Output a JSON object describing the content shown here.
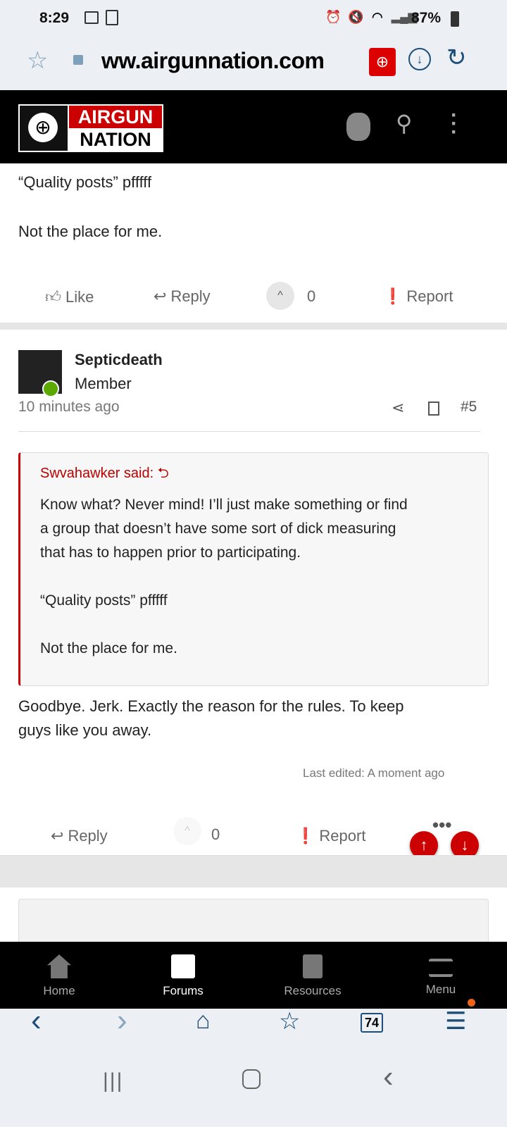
{
  "status": {
    "time": "8:29",
    "battery": "87%"
  },
  "browser": {
    "url": "ww.airgunnation.com",
    "tab_count": "74"
  },
  "logo": {
    "line1": "AIRGUN",
    "line2": "NATION"
  },
  "prev_post": {
    "line1": "“Quality posts” pfffff",
    "line2": "Not the place for me.",
    "like": "Like",
    "reply": "Reply",
    "votes": "0",
    "report": "Report"
  },
  "post": {
    "author": "Septicdeath",
    "role": "Member",
    "time": "10 minutes ago",
    "number": "#5",
    "quote_author": "Swvahawker said:",
    "quote_lines": [
      "Know what? Never mind! I’ll just make something or find",
      "a group that doesn’t have some sort of dick measuring",
      "that has to happen prior to participating.",
      "“Quality posts” pfffff",
      "Not the place for me."
    ],
    "body_lines": [
      "Goodbye. Jerk. Exactly the reason for the rules. To keep",
      "guys like you away."
    ],
    "edited": "Last edited: A moment ago",
    "reply": "Reply",
    "votes": "0",
    "report": "Report"
  },
  "nav": {
    "items": [
      {
        "label": "Home"
      },
      {
        "label": "Forums"
      },
      {
        "label": "Resources"
      },
      {
        "label": "Menu"
      }
    ]
  }
}
